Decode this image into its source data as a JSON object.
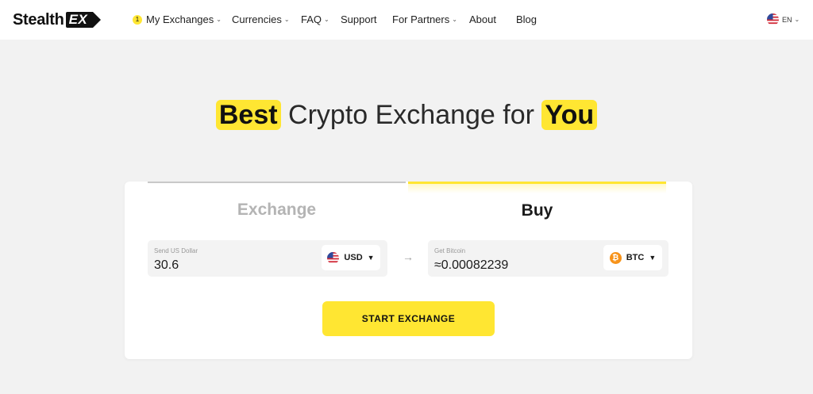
{
  "header": {
    "logo": {
      "text": "Stealth",
      "badge": "EX"
    },
    "nav": [
      {
        "label": "My Exchanges",
        "badge": "1",
        "has_dropdown": true
      },
      {
        "label": "Currencies",
        "has_dropdown": true
      },
      {
        "label": "FAQ",
        "has_dropdown": true
      },
      {
        "label": "Support",
        "has_dropdown": false
      },
      {
        "label": "For Partners",
        "has_dropdown": true
      },
      {
        "label": "About",
        "has_dropdown": false
      },
      {
        "label": "Blog",
        "has_dropdown": false
      }
    ],
    "language": {
      "code": "EN",
      "icon": "us-flag-icon"
    }
  },
  "hero": {
    "highlight_1": "Best",
    "middle": "Crypto Exchange for",
    "highlight_2": "You"
  },
  "widget": {
    "tabs": [
      {
        "label": "Exchange",
        "active": false
      },
      {
        "label": "Buy",
        "active": true
      }
    ],
    "send": {
      "label": "Send US Dollar",
      "value": "30.6",
      "currency": "USD",
      "icon": "us-flag-icon"
    },
    "arrow_icon": "arrow-right-icon",
    "get": {
      "label": "Get Bitcoin",
      "value": "≈0.00082239",
      "currency": "BTC",
      "icon": "bitcoin-icon"
    },
    "submit_label": "START EXCHANGE"
  },
  "colors": {
    "accent": "#ffe632",
    "background": "#f2f2f2",
    "card": "#ffffff",
    "inactive_tab": "#b4b4b4",
    "bitcoin": "#f7931a"
  }
}
